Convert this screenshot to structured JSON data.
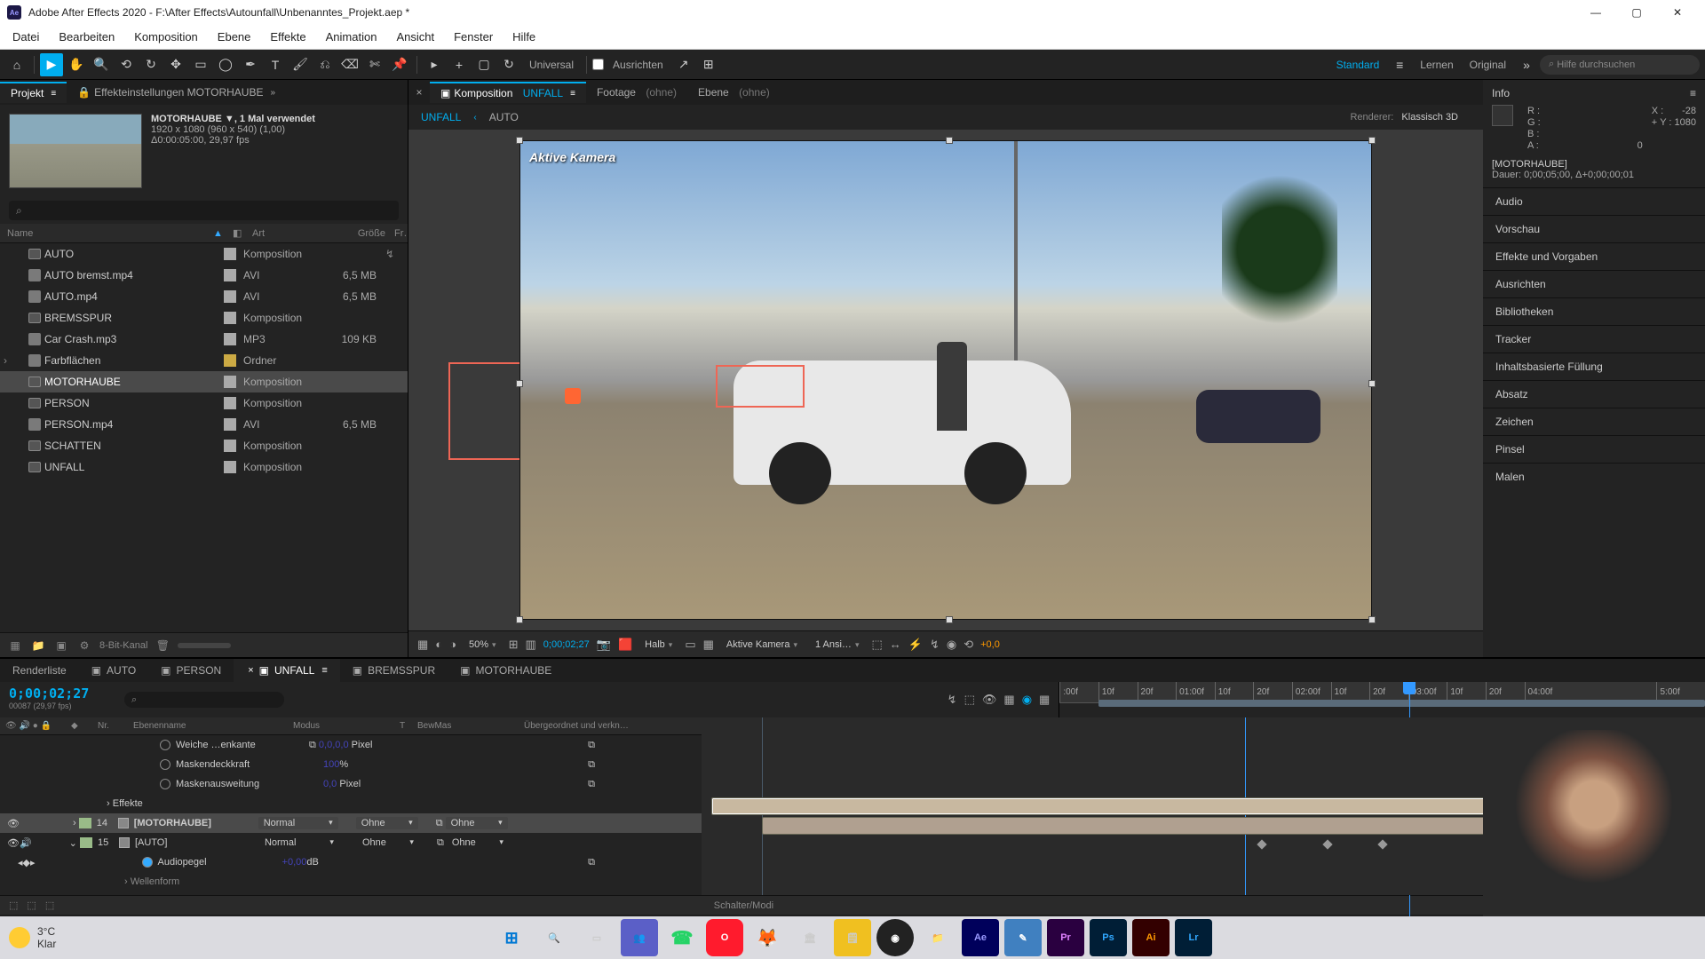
{
  "title_bar": {
    "app": "Adobe After Effects 2020",
    "path": "F:\\After Effects\\Autounfall\\Unbenanntes_Projekt.aep *"
  },
  "menu": [
    "Datei",
    "Bearbeiten",
    "Komposition",
    "Ebene",
    "Effekte",
    "Animation",
    "Ansicht",
    "Fenster",
    "Hilfe"
  ],
  "toolbar": {
    "universal": "Universal",
    "ausrichten": "Ausrichten",
    "workspace_standard": "Standard",
    "workspace_lernen": "Lernen",
    "workspace_original": "Original",
    "search_placeholder": "Hilfe durchsuchen"
  },
  "project": {
    "tab_projekt": "Projekt",
    "tab_effekte": "Effekteinstellungen MOTORHAUBE",
    "selected_name": "MOTORHAUBE",
    "usage": ", 1 Mal verwendet",
    "dims": "1920 x 1080 (960 x 540) (1,00)",
    "duration": "Δ0:00:05:00, 29,97 fps",
    "columns": {
      "name": "Name",
      "art": "Art",
      "size": "Größe",
      "fr": "Fr…"
    },
    "items": [
      {
        "name": "AUTO",
        "art": "Komposition",
        "size": "",
        "link": true
      },
      {
        "name": "AUTO bremst.mp4",
        "art": "AVI",
        "size": "6,5 MB"
      },
      {
        "name": "AUTO.mp4",
        "art": "AVI",
        "size": "6,5 MB"
      },
      {
        "name": "BREMSSPUR",
        "art": "Komposition",
        "size": ""
      },
      {
        "name": "Car Crash.mp3",
        "art": "MP3",
        "size": "109 KB"
      },
      {
        "name": "Farbflächen",
        "art": "Ordner",
        "size": "",
        "yellow": true
      },
      {
        "name": "MOTORHAUBE",
        "art": "Komposition",
        "size": "",
        "selected": true
      },
      {
        "name": "PERSON",
        "art": "Komposition",
        "size": ""
      },
      {
        "name": "PERSON.mp4",
        "art": "AVI",
        "size": "6,5 MB"
      },
      {
        "name": "SCHATTEN",
        "art": "Komposition",
        "size": ""
      },
      {
        "name": "UNFALL",
        "art": "Komposition",
        "size": ""
      }
    ],
    "footer_bits": "8-Bit-Kanal"
  },
  "comp": {
    "tab_comp": "Komposition",
    "tab_comp_name": "UNFALL",
    "tab_footage": "Footage",
    "tab_ebene": "Ebene",
    "none": "(ohne)",
    "bc_active": "UNFALL",
    "bc_second": "AUTO",
    "renderer_label": "Renderer:",
    "renderer_value": "Klassisch 3D",
    "camera_label": "Aktive Kamera",
    "footer": {
      "zoom": "50%",
      "time": "0;00;02;27",
      "res": "Halb",
      "view": "Aktive Kamera",
      "views": "1 Ansi…",
      "exposure": "+0,0"
    }
  },
  "info": {
    "title": "Info",
    "r": "R :",
    "g": "G :",
    "b": "B :",
    "a": "A :",
    "a_val": "0",
    "x_label": "X :",
    "x_val": "-28",
    "y_label": "Y :",
    "y_val": "1080",
    "layer": "[MOTORHAUBE]",
    "dauer": "Dauer: 0;00;05;00, Δ+0;00;00;01"
  },
  "panels": [
    "Audio",
    "Vorschau",
    "Effekte und Vorgaben",
    "Ausrichten",
    "Bibliotheken",
    "Tracker",
    "Inhaltsbasierte Füllung",
    "Absatz",
    "Zeichen",
    "Pinsel",
    "Malen"
  ],
  "timeline": {
    "tabs": [
      {
        "label": "Renderliste"
      },
      {
        "label": "AUTO"
      },
      {
        "label": "PERSON"
      },
      {
        "label": "UNFALL",
        "active": true
      },
      {
        "label": "BREMSSPUR"
      },
      {
        "label": "MOTORHAUBE"
      }
    ],
    "timecode": "0;00;02;27",
    "frame_sub": "00087 (29,97 fps)",
    "ruler": [
      {
        "label": ":00f",
        "pos": 0
      },
      {
        "label": "10f",
        "pos": 6
      },
      {
        "label": "20f",
        "pos": 12
      },
      {
        "label": "01:00f",
        "pos": 18
      },
      {
        "label": "10f",
        "pos": 24
      },
      {
        "label": "20f",
        "pos": 30
      },
      {
        "label": "02:00f",
        "pos": 36
      },
      {
        "label": "10f",
        "pos": 42
      },
      {
        "label": "20f",
        "pos": 48
      },
      {
        "label": "03:00f",
        "pos": 54
      },
      {
        "label": "10f",
        "pos": 60
      },
      {
        "label": "20f",
        "pos": 66
      },
      {
        "label": "04:00f",
        "pos": 72
      },
      {
        "label": "5:00f",
        "pos": 92.5
      }
    ],
    "columns": {
      "nr": "Nr.",
      "name": "Ebenenname",
      "modus": "Modus",
      "t": "T",
      "bewmas": "BewMas",
      "parent": "Übergeordnet und verkn…"
    },
    "rows": {
      "weiche": "Weiche …enkante",
      "weiche_val": "0,0,0,0",
      "weiche_unit": "Pixel",
      "deckkraft": "Maskendeckkraft",
      "deckkraft_val": "100",
      "deckkraft_unit": "%",
      "ausweitung": "Maskenausweitung",
      "ausweitung_val": "0,0",
      "ausweitung_unit": "Pixel",
      "effekte": "Effekte",
      "layer14_nr": "14",
      "layer14_name": "[MOTORHAUBE]",
      "layer15_nr": "15",
      "layer15_name": "[AUTO]",
      "audiopegel": "Audiopegel",
      "audiopegel_val": "+0,00",
      "audiopegel_unit": "dB",
      "wellenform": "Wellenform",
      "normal": "Normal",
      "ohne": "Ohne"
    },
    "footer": "Schalter/Modi"
  },
  "taskbar": {
    "temp": "3°C",
    "condition": "Klar"
  }
}
